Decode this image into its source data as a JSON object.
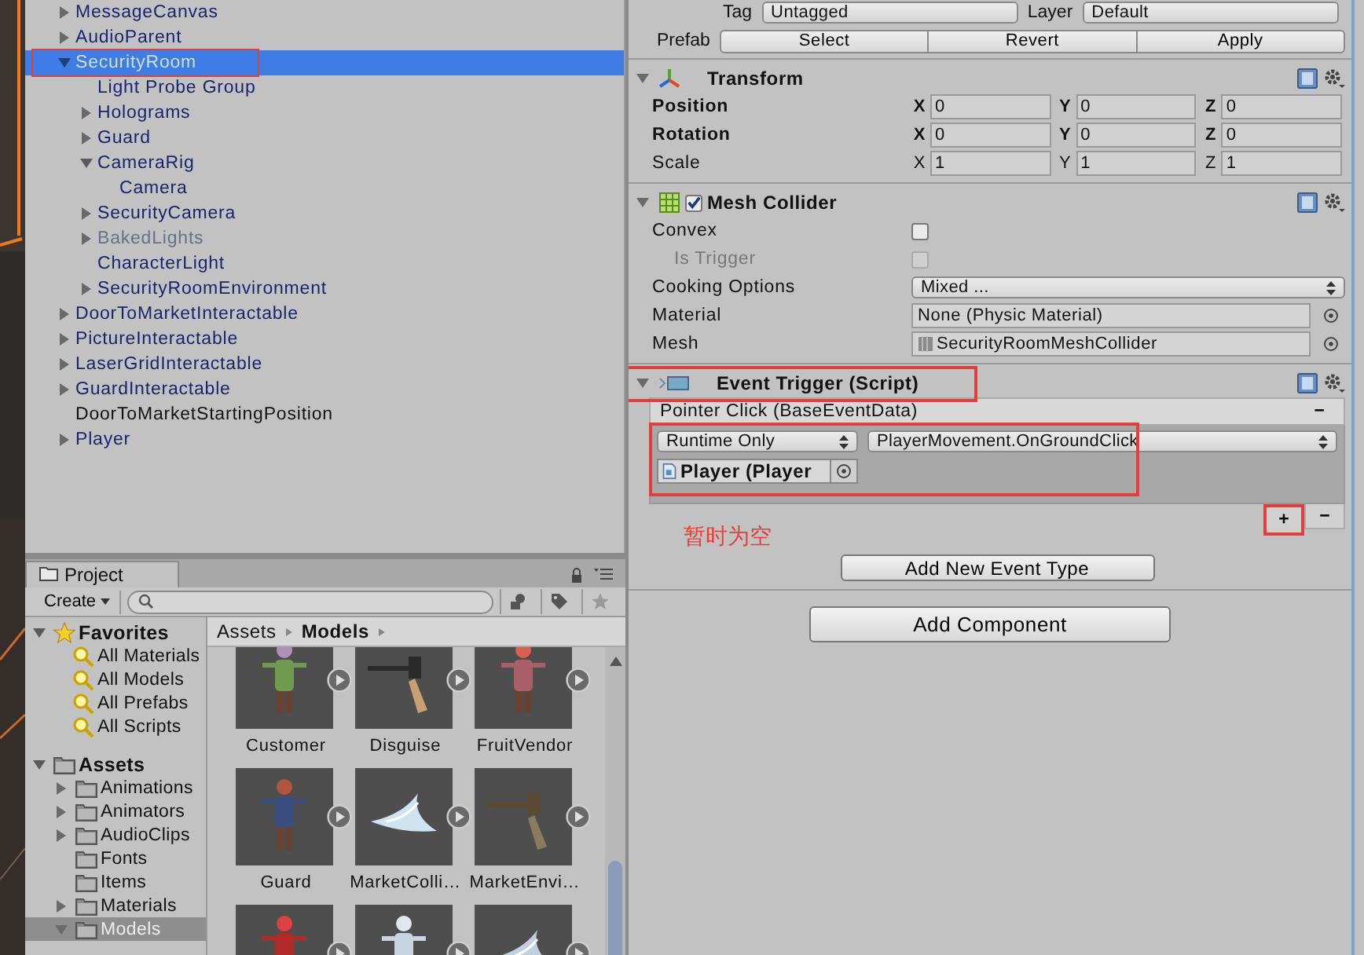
{
  "hierarchy": {
    "items": [
      {
        "name": "MessageCanvas",
        "kind": "parent",
        "expanded": false,
        "prefab": true,
        "disabled": false,
        "selected": false,
        "highlighted": false
      },
      {
        "name": "AudioParent",
        "kind": "parent",
        "expanded": false,
        "prefab": true,
        "disabled": false,
        "selected": false,
        "highlighted": false
      },
      {
        "name": "SecurityRoom",
        "kind": "parent",
        "expanded": true,
        "prefab": true,
        "disabled": false,
        "selected": true,
        "highlighted": true,
        "children": [
          {
            "name": "Light Probe Group",
            "kind": "leaf",
            "prefab": true,
            "disabled": false,
            "selected": false,
            "highlighted": false
          },
          {
            "name": "Holograms",
            "kind": "parent",
            "expanded": false,
            "prefab": true,
            "disabled": false,
            "selected": false,
            "highlighted": false
          },
          {
            "name": "Guard",
            "kind": "parent",
            "expanded": false,
            "prefab": true,
            "disabled": false,
            "selected": false,
            "highlighted": false
          },
          {
            "name": "CameraRig",
            "kind": "parent",
            "expanded": true,
            "prefab": true,
            "disabled": false,
            "selected": false,
            "highlighted": false,
            "children": [
              {
                "name": "Camera",
                "kind": "leaf",
                "prefab": true,
                "disabled": false,
                "selected": false,
                "highlighted": false
              }
            ]
          },
          {
            "name": "SecurityCamera",
            "kind": "parent",
            "expanded": false,
            "prefab": true,
            "disabled": false,
            "selected": false,
            "highlighted": false
          },
          {
            "name": "BakedLights",
            "kind": "parent",
            "expanded": false,
            "prefab": true,
            "disabled": true,
            "selected": false,
            "highlighted": false
          },
          {
            "name": "CharacterLight",
            "kind": "leaf",
            "prefab": true,
            "disabled": false,
            "selected": false,
            "highlighted": false
          },
          {
            "name": "SecurityRoomEnvironment",
            "kind": "parent",
            "expanded": false,
            "prefab": true,
            "disabled": false,
            "selected": false,
            "highlighted": false
          }
        ]
      },
      {
        "name": "DoorToMarketInteractable",
        "kind": "parent",
        "expanded": false,
        "prefab": true,
        "disabled": false,
        "selected": false,
        "highlighted": false
      },
      {
        "name": "PictureInteractable",
        "kind": "parent",
        "expanded": false,
        "prefab": true,
        "disabled": false,
        "selected": false,
        "highlighted": false
      },
      {
        "name": "LaserGridInteractable",
        "kind": "parent",
        "expanded": false,
        "prefab": true,
        "disabled": false,
        "selected": false,
        "highlighted": false
      },
      {
        "name": "GuardInteractable",
        "kind": "parent",
        "expanded": false,
        "prefab": true,
        "disabled": false,
        "selected": false,
        "highlighted": false
      },
      {
        "name": "DoorToMarketStartingPosition",
        "kind": "leaf",
        "prefab": false,
        "disabled": false,
        "selected": false,
        "highlighted": false
      },
      {
        "name": "Player",
        "kind": "parent",
        "expanded": false,
        "prefab": true,
        "disabled": false,
        "selected": false,
        "highlighted": false
      }
    ]
  },
  "inspector": {
    "tag_row": {
      "tag_label": "Tag",
      "tag": "Untagged",
      "layer_label": "Layer",
      "layer": "Default"
    },
    "prefab": {
      "label": "Prefab",
      "buttons": [
        "Select",
        "Revert",
        "Apply"
      ]
    },
    "components": [
      {
        "kind": "transform",
        "title": "Transform",
        "highlighted": false,
        "rows": [
          {
            "label": "Position",
            "overridden": true,
            "values": [
              {
                "axis": "X",
                "value": "0"
              },
              {
                "axis": "Y",
                "value": "0"
              },
              {
                "axis": "Z",
                "value": "0"
              }
            ]
          },
          {
            "label": "Rotation",
            "overridden": true,
            "values": [
              {
                "axis": "X",
                "value": "0"
              },
              {
                "axis": "Y",
                "value": "0"
              },
              {
                "axis": "Z",
                "value": "0"
              }
            ]
          },
          {
            "label": "Scale",
            "overridden": false,
            "values": [
              {
                "axis": "X",
                "value": "1"
              },
              {
                "axis": "Y",
                "value": "1"
              },
              {
                "axis": "Z",
                "value": "1"
              }
            ]
          }
        ]
      },
      {
        "kind": "mesh_collider",
        "title": "Mesh Collider",
        "enabled": true,
        "highlighted": false,
        "fields": [
          {
            "kind": "checkbox",
            "label": "Convex",
            "checked": false,
            "disabled": false
          },
          {
            "kind": "checkbox",
            "label": "Is Trigger",
            "checked": false,
            "disabled": true
          },
          {
            "kind": "dropdown",
            "label": "Cooking Options",
            "value": "Mixed ..."
          },
          {
            "kind": "object",
            "label": "Material",
            "value": "None (Physic Material)",
            "icon": false
          },
          {
            "kind": "object",
            "label": "Mesh",
            "value": "SecurityRoomMeshCollider",
            "icon": true
          }
        ]
      },
      {
        "kind": "event_trigger",
        "title": "Event Trigger (Script)",
        "highlighted": true,
        "events": [
          {
            "title": "Pointer Click (BaseEventData)",
            "remove": "−",
            "listeners_highlighted": true,
            "listeners": [
              {
                "mode": "Runtime Only",
                "function": "PlayerMovement.OnGroundClick",
                "target": "Player (Player"
              }
            ],
            "add": "+",
            "add_highlighted": true,
            "remove_listener": "−"
          }
        ],
        "note": "暂时为空",
        "add_event_button": "Add New Event Type"
      }
    ],
    "add_component": "Add Component"
  },
  "project": {
    "tab": "Project",
    "create": "Create",
    "favorites": {
      "title": "Favorites",
      "expanded": true,
      "items": [
        "All Materials",
        "All Models",
        "All Prefabs",
        "All Scripts"
      ]
    },
    "assets": {
      "title": "Assets",
      "expanded": true,
      "children": [
        {
          "name": "Animations",
          "kind": "parent",
          "expanded": false,
          "selected": false
        },
        {
          "name": "Animators",
          "kind": "parent",
          "expanded": false,
          "selected": false
        },
        {
          "name": "AudioClips",
          "kind": "parent",
          "expanded": false,
          "selected": false
        },
        {
          "name": "Fonts",
          "kind": "leaf",
          "selected": false
        },
        {
          "name": "Items",
          "kind": "leaf",
          "selected": false
        },
        {
          "name": "Materials",
          "kind": "parent",
          "expanded": false,
          "selected": false
        },
        {
          "name": "Models",
          "kind": "parent",
          "expanded": true,
          "selected": true
        }
      ]
    },
    "breadcrumb": [
      "Assets",
      "Models"
    ],
    "thumbnails": [
      {
        "label": "Customer",
        "kind": "picture"
      },
      {
        "label": "Disguise",
        "kind": "picture"
      },
      {
        "label": "FruitVendor",
        "kind": "picture"
      },
      {
        "label": "Guard",
        "kind": "picture"
      },
      {
        "label": "MarketColli…",
        "kind": "picture"
      },
      {
        "label": "MarketEnvi…",
        "kind": "picture"
      },
      {
        "kind": "picture"
      },
      {
        "kind": "picture"
      },
      {
        "kind": "picture"
      }
    ]
  }
}
